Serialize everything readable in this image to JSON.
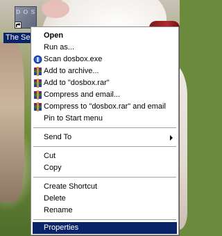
{
  "desktop": {
    "icon_name": "dosbox-icon",
    "icon_letters": "D O S",
    "icon_label": "The Se"
  },
  "context_menu": {
    "items": [
      {
        "label": "Open",
        "bold": true
      },
      {
        "label": "Run as..."
      },
      {
        "label": "Scan dosbox.exe",
        "icon": "antivirus-icon"
      },
      {
        "label": "Add to archive...",
        "icon": "winrar-icon"
      },
      {
        "label": "Add to \"dosbox.rar\"",
        "icon": "winrar-icon"
      },
      {
        "label": "Compress and email...",
        "icon": "winrar-icon"
      },
      {
        "label": "Compress to \"dosbox.rar\" and email",
        "icon": "winrar-icon"
      },
      {
        "label": "Pin to Start menu"
      },
      {
        "label": "Send To",
        "submenu": true
      },
      {
        "label": "Cut"
      },
      {
        "label": "Copy"
      },
      {
        "label": "Create Shortcut"
      },
      {
        "label": "Delete"
      },
      {
        "label": "Rename"
      },
      {
        "label": "Properties",
        "selected": true
      }
    ]
  },
  "colors": {
    "selection": "#0a246a",
    "menu_bg": "#ffffff"
  }
}
